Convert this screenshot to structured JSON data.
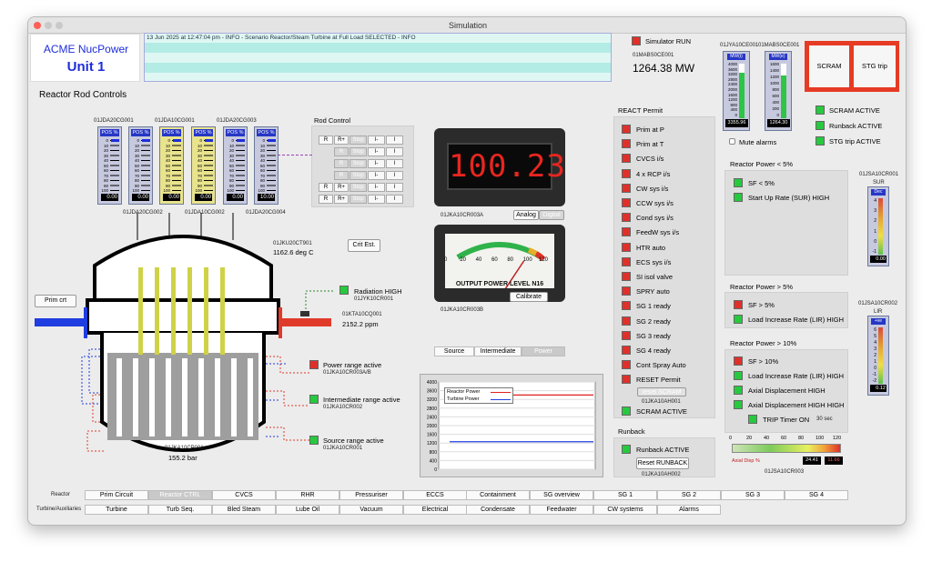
{
  "window": {
    "title": "Simulation"
  },
  "brand": {
    "company": "ACME NucPower",
    "unit": "Unit 1"
  },
  "log": {
    "message": "13 Jun 2025 at 12:47:04 pm - INFO - Scenario Reactor/Steam Turbine at Full Load SELECTED - INFO"
  },
  "sim": {
    "run_label": "Simulator RUN",
    "power_tag": "01MABS0CE001",
    "power_value": "1264.38 MW"
  },
  "top_gauges": {
    "g1": {
      "tag": "01JYA10CE001",
      "header": "MW(t)",
      "scale": [
        "4000",
        "3600",
        "3200",
        "2800",
        "2400",
        "2000",
        "1600",
        "1200",
        "800",
        "400",
        "0"
      ],
      "value": "3355.96",
      "level": 0.84
    },
    "g2": {
      "tag": "01MABS0CE001",
      "header": "MW(e)",
      "scale": [
        "1600",
        "1400",
        "1200",
        "1000",
        "800",
        "600",
        "400",
        "200",
        "0"
      ],
      "value": "1264.30",
      "level": 0.79
    },
    "mute": "Mute alarms"
  },
  "scram_buttons": {
    "scram": "SCRAM",
    "stg": "STG trip"
  },
  "status": {
    "scram_active": "SCRAM ACTIVE",
    "runback_active": "Runback ACTIVE",
    "stg_trip_active": "STG trip ACTIVE"
  },
  "rod": {
    "title": "Reactor Rod Controls",
    "tags_top": [
      "01JDA20CG001",
      "01JDA10CG001",
      "01JDA20CG003"
    ],
    "tags_bottom": [
      "01JDA20CG002",
      "01JDA10CG002",
      "01JDA20CG004"
    ],
    "gauge_header": "POS %",
    "scale": [
      "0",
      "10",
      "20",
      "30",
      "40",
      "50",
      "60",
      "70",
      "80",
      "90",
      "100"
    ],
    "values": [
      "0.00",
      "0.00",
      "0.00",
      "0.00",
      "0.00",
      "10.00"
    ],
    "control_title": "Rod Control",
    "buttons": {
      "r": "R",
      "rplus": "R+",
      "stop": "Stop",
      "iminus": "I-",
      "i": "I"
    }
  },
  "vessel": {
    "temp_tag": "01JKU20CT901",
    "temp_value": "1162.6 deg C",
    "crit_button": "Crit Est.",
    "prim_button": "Prim crt",
    "radiation_label": "Radiation HIGH",
    "radiation_tag": "01JYK10CR001",
    "boron_tag": "01KTA10CQ001",
    "boron_value": "2152.2 ppm",
    "power_range_label": "Power range active",
    "power_range_tag": "01JKA10CR003A/B",
    "intermediate_label": "Intermediate range active",
    "intermediate_tag": "01JKA10CR002",
    "source_label": "Source range active",
    "source_tag": "01JKA10CR001",
    "pressure_tag": "01JKA10CP001",
    "pressure_value": "155.2 bar"
  },
  "digital_meter": {
    "value": "100.23",
    "tag": "01JKA10CR003A",
    "analog": "Analog",
    "digital": "Digital"
  },
  "analog_meter": {
    "title": "OUTPUT POWER LEVEL N16",
    "scale": [
      "0",
      "20",
      "40",
      "60",
      "80",
      "100",
      "120"
    ],
    "value": 100,
    "calibrate": "Calibrate",
    "tag": "01JKA10CR003B"
  },
  "range_tabs": [
    "Source",
    "Intermediate",
    "Power"
  ],
  "trend": {
    "legend": [
      "Reactor Power",
      "Turbine Power"
    ],
    "yticks": [
      "4000",
      "3600",
      "3200",
      "2800",
      "2400",
      "2000",
      "1600",
      "1200",
      "800",
      "400",
      "0"
    ]
  },
  "chart_data": {
    "type": "line",
    "ylim": [
      0,
      4000
    ],
    "series": [
      {
        "name": "Reactor Power",
        "color": "#e02020",
        "values": [
          3400,
          3400,
          3400,
          3400
        ]
      },
      {
        "name": "Turbine Power",
        "color": "#2040e0",
        "values": [
          1260,
          1260,
          1260,
          1260
        ]
      }
    ]
  },
  "react_permit": {
    "title": "REACT Permit",
    "items": [
      "Prim at P",
      "Prim at T",
      "CVCS i/s",
      "4 x RCP i/s",
      "CW sys i/s",
      "CCW sys i/s",
      "Cond sys i/s",
      "FeedW sys i/s",
      "HTR auto",
      "ECS sys i/s",
      "SI isol valve",
      "SPRY auto",
      "SG 1 ready",
      "SG 2 ready",
      "SG 3 ready",
      "SG 4 ready",
      "Cont Spray Auto",
      "RESET Permit"
    ],
    "reset_scram": "reset SCRAM",
    "reset_tag": "01JKA10AH001",
    "scram_active": "SCRAM ACTIVE"
  },
  "runback": {
    "title": "Runback",
    "active": "Runback ACTIVE",
    "reset": "Reset RUNBACK",
    "tag": "01JKA10AH002"
  },
  "rp_lt5": {
    "title": "Reactor Power < 5%",
    "sf": "SF < 5%",
    "sur": "Start Up Rate (SUR) HIGH",
    "gauge_tag": "01JSA10CR001",
    "gauge_name": "SUR",
    "gauge_header": "Dec",
    "scale": [
      "4",
      "3",
      "2",
      "1",
      "0",
      "-1"
    ],
    "value": "0.00"
  },
  "rp_gt5": {
    "title": "Reactor Power > 5%",
    "sf": "SF > 5%",
    "lir": "Load Increase Rate (LIR) HIGH"
  },
  "rp_gt10": {
    "title": "Reactor Power > 10%",
    "sf": "SF > 10%",
    "lir": "Load Increase Rate (LIR) HIGH",
    "axial": "Axial Displacement HIGH",
    "axial_hh": "Axial Displacement HIGH HIGH",
    "trip": "TRIP Timer ON",
    "timer": "30 sec"
  },
  "lir_gauge": {
    "tag": "01JSA10CR002",
    "name": "LIR",
    "header": "+ve",
    "scale": [
      "6",
      "5",
      "4",
      "3",
      "2",
      "1",
      "0",
      "-1",
      "-2"
    ],
    "value": "0.12"
  },
  "axial": {
    "scale": [
      "0",
      "20",
      "40",
      "60",
      "80",
      "100",
      "120"
    ],
    "label": "Axial Disp %",
    "v1": "24.41",
    "v2": "11.66",
    "tag": "01JSA10CR003"
  },
  "nav": {
    "reactor_label": "Reactor",
    "turbine_label": "Turbine/Auxiliaries",
    "reactor_tabs": [
      "Prim Circuit",
      "Reactor CTRL",
      "CVCS",
      "RHR",
      "Pressuriser",
      "ECCS",
      "Containment",
      "SG overview",
      "SG 1",
      "SG 2",
      "SG 3",
      "SG 4"
    ],
    "turbine_tabs": [
      "Turbine",
      "Turb Seq.",
      "Bled Steam",
      "Lube Oil",
      "Vacuum",
      "Electrical",
      "Condensate",
      "Feedwater",
      "CW systems",
      "Alarms"
    ]
  }
}
